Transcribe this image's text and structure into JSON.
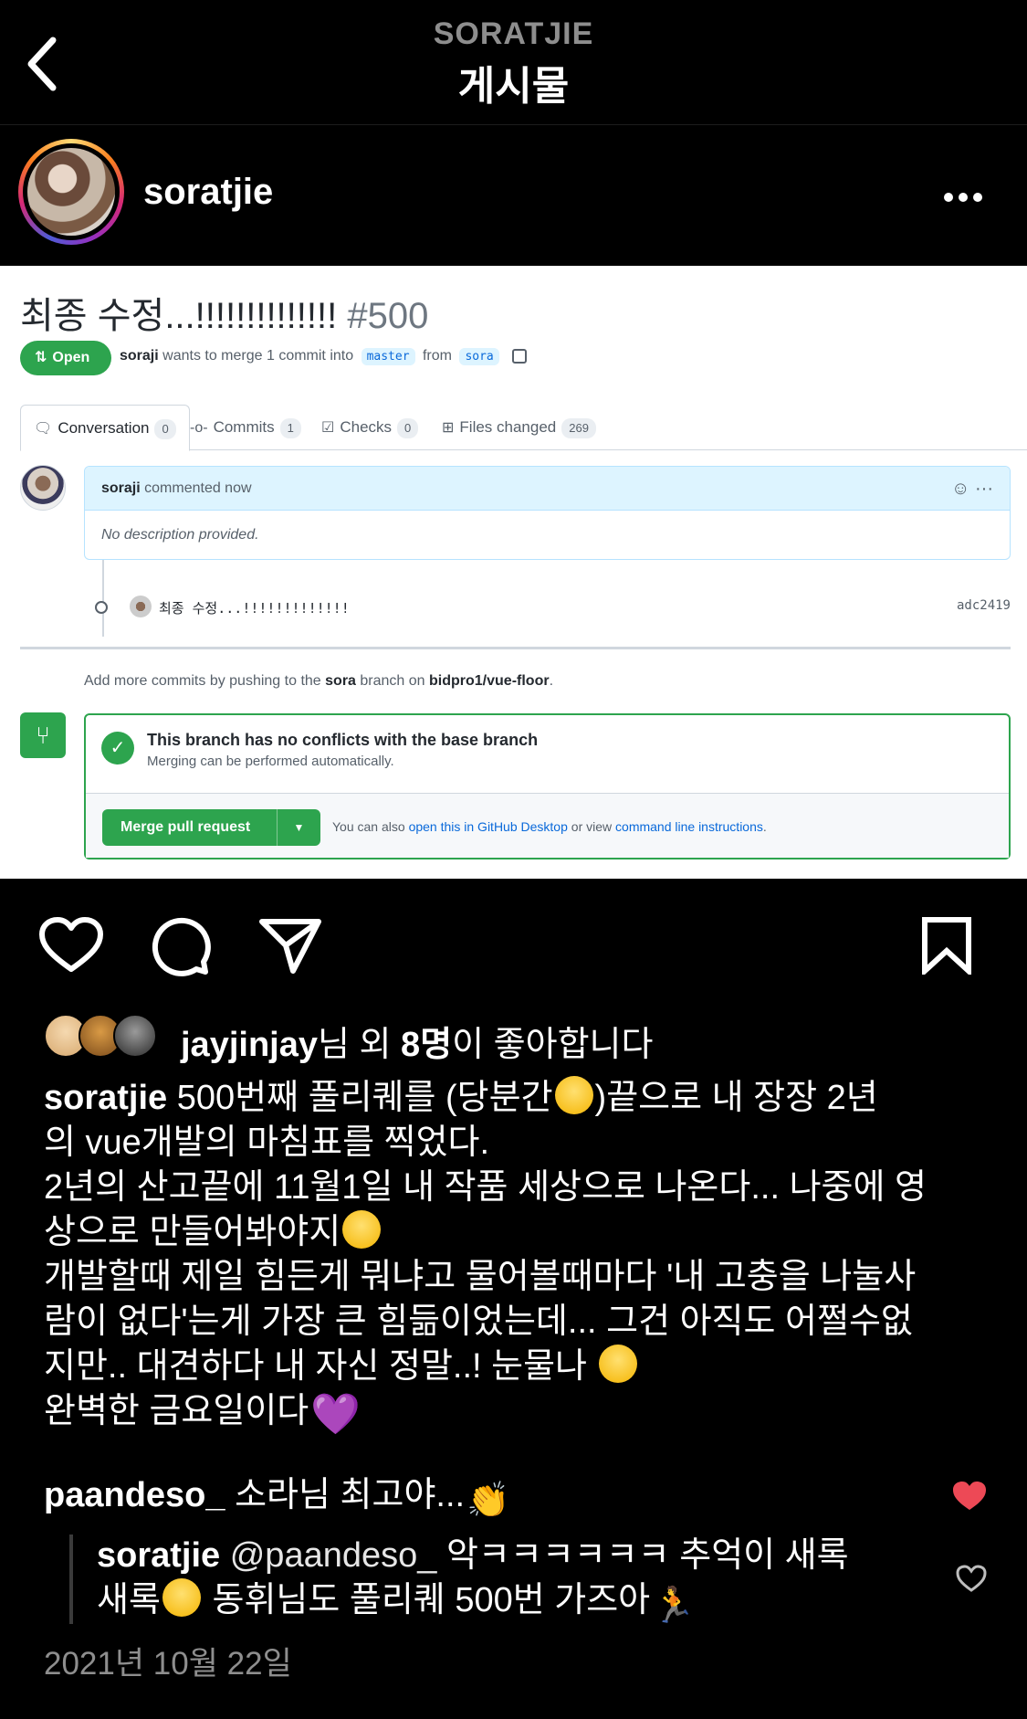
{
  "topbar": {
    "account": "SORATJIE",
    "title": "게시물"
  },
  "post": {
    "username": "soratjie"
  },
  "pr": {
    "title": "최종 수정...!!!!!!!!!!!!!!",
    "number": "#500",
    "status": "Open",
    "author": "soraji",
    "meta_mid": "wants to merge 1 commit into",
    "base_branch": "master",
    "from_label": "from",
    "head_branch": "sora",
    "tabs": [
      {
        "label": "Conversation",
        "count": "0"
      },
      {
        "label": "Commits",
        "count": "1"
      },
      {
        "label": "Checks",
        "count": "0"
      },
      {
        "label": "Files changed",
        "count": "269"
      }
    ],
    "comment_author": "soraji",
    "comment_time": "commented now",
    "comment_body": "No description provided.",
    "commit_message": "최종 수정...!!!!!!!!!!!!!",
    "commit_sha": "adc2419",
    "add_more_pre": "Add more commits by pushing to the",
    "add_more_branch": "sora",
    "add_more_mid": "branch on",
    "add_more_repo": "bidpro1/vue-floor",
    "add_more_end": ".",
    "merge_title": "This branch has no conflicts with the base branch",
    "merge_sub": "Merging can be performed automatically.",
    "merge_button": "Merge pull request",
    "hint_pre": "You can also",
    "hint_link1": "open this in GitHub Desktop",
    "hint_mid": "or view",
    "hint_link2": "command line instructions",
    "hint_end": "."
  },
  "likes": {
    "user": "jayjinjay",
    "suffix1": "님 외 ",
    "count": "8명",
    "suffix2": "이 좋아합니다"
  },
  "caption": {
    "user": "soratjie",
    "line1_a": "500번째 풀리퀘를 (당분간",
    "line1_b": ")끝으로 내 장장 2년",
    "line2": "의 vue개발의 마침표를 찍었다.",
    "line3": "2년의 산고끝에 11월1일 내 작품 세상으로 나온다... 나중에 영",
    "line4": "상으로 만들어봐야지",
    "line5": "개발할때 제일 힘든게 뭐냐고 물어볼때마다 '내 고충을 나눌사",
    "line6": "람이 없다'는게 가장 큰 힘듦이었는데... 그건 아직도 어쩔수없",
    "line7": "지만.. 대견하다 내 자신 정말..! 눈물나",
    "line8": "완벽한 금요일이다",
    "heart": "💜"
  },
  "comment1": {
    "user": "paandeso_",
    "text": "소라님 최고야...",
    "emoji": "👏"
  },
  "reply": {
    "user": "soratjie",
    "mention": "@paandeso_",
    "text1": "악ㅋㅋㅋㅋㅋㅋ 추억이 새록",
    "text2a": "새록",
    "text2b": "동휘님도 풀리퀘 500번 가즈아",
    "emoji": "🏃"
  },
  "date": "2021년 10월 22일",
  "colors": {
    "like_red": "#ed4956",
    "github_green": "#2da44e",
    "link_blue": "#0969da"
  }
}
